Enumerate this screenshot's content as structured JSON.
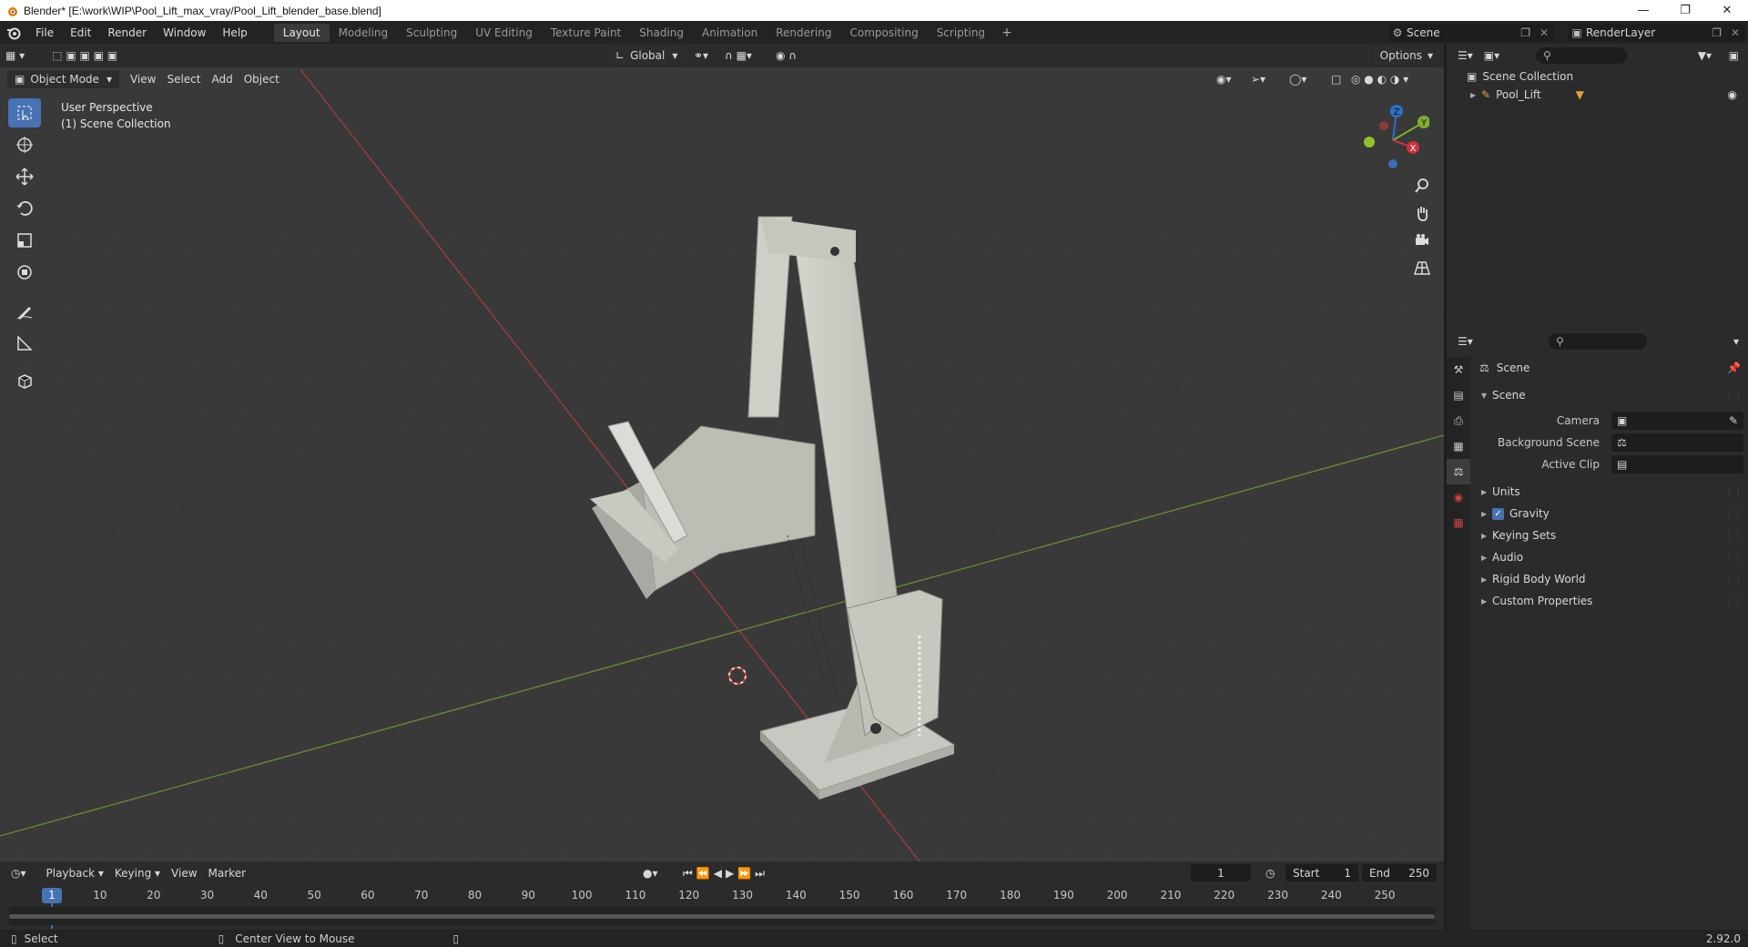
{
  "window": {
    "title": "Blender* [E:\\work\\WIP\\Pool_Lift_max_vray/Pool_Lift_blender_base.blend]"
  },
  "menu": {
    "items": [
      "File",
      "Edit",
      "Render",
      "Window",
      "Help"
    ]
  },
  "workspaces": {
    "tabs": [
      "Layout",
      "Modeling",
      "Sculpting",
      "UV Editing",
      "Texture Paint",
      "Shading",
      "Animation",
      "Rendering",
      "Compositing",
      "Scripting"
    ],
    "active": "Layout"
  },
  "scene_selector": {
    "value": "Scene"
  },
  "renderlayer_selector": {
    "value": "RenderLayer"
  },
  "viewport": {
    "mode": "Object Mode",
    "menus": [
      "View",
      "Select",
      "Add",
      "Object"
    ],
    "orientation": "Global",
    "options_label": "Options",
    "overlay_line1": "User Perspective",
    "overlay_line2": "(1) Scene Collection",
    "gizmo_axes": {
      "x": "X",
      "y": "Y",
      "z": "Z"
    }
  },
  "timeline": {
    "menus": [
      "Playback",
      "Keying",
      "View",
      "Marker"
    ],
    "current_frame": "1",
    "start_label": "Start",
    "start_value": "1",
    "end_label": "End",
    "end_value": "250",
    "ruler": [
      "1",
      "10",
      "20",
      "30",
      "40",
      "50",
      "60",
      "70",
      "80",
      "90",
      "100",
      "110",
      "120",
      "130",
      "140",
      "150",
      "160",
      "170",
      "180",
      "190",
      "200",
      "210",
      "220",
      "230",
      "240",
      "250"
    ]
  },
  "statusbar": {
    "left": "Select",
    "middle": "Center View to Mouse",
    "version": "2.92.0"
  },
  "outliner": {
    "collection": "Scene Collection",
    "object": "Pool_Lift"
  },
  "properties": {
    "context": "Scene",
    "panel_title": "Scene",
    "camera_label": "Camera",
    "background_scene_label": "Background Scene",
    "active_clip_label": "Active Clip",
    "panels": [
      "Units",
      "Gravity",
      "Keying Sets",
      "Audio",
      "Rigid Body World",
      "Custom Properties"
    ],
    "gravity_checked": true
  },
  "colors": {
    "accent": "#4772b3",
    "viewport_bg": "#393939",
    "panel_bg": "#2b2b2b",
    "x_axis": "#c7343b",
    "y_axis": "#7fae2b",
    "z_axis": "#2b72c8"
  }
}
